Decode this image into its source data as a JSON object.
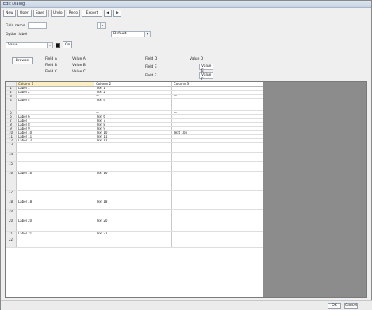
{
  "window": {
    "title": "Edit Dialog"
  },
  "toolbar": {
    "buttons": [
      {
        "name": "new-button",
        "label": "New"
      },
      {
        "name": "open-button",
        "label": "Open"
      },
      {
        "name": "save-button",
        "label": "Save"
      },
      {
        "name": "undo-button",
        "label": "Undo"
      },
      {
        "name": "redo-button",
        "label": "Redo"
      },
      {
        "name": "export-button",
        "label": "Export"
      },
      {
        "name": "prev-button",
        "label": "◀"
      },
      {
        "name": "next-button",
        "label": "▶"
      }
    ]
  },
  "settings": {
    "row1_label": "Field name",
    "row1_value": "",
    "row2_label": "Option label",
    "row2_value": "Default",
    "row3_value": "Value",
    "row3_check": "On",
    "ref_button": "Browse",
    "cols": [
      [
        "Field A",
        "Value A"
      ],
      [
        "Field B",
        "Value B"
      ],
      [
        "Field C",
        "Value C"
      ],
      [
        "Field D",
        "Value D"
      ],
      [
        "Field E",
        "Value E"
      ],
      [
        "Field F",
        "Value F"
      ]
    ]
  },
  "grid": {
    "headers": [
      "",
      "Column 1",
      "Column 2",
      "Column 3"
    ],
    "rows": [
      {
        "n": "1",
        "a": "Label 1",
        "b": "Text 1",
        "c": "",
        "h": 5
      },
      {
        "n": "2",
        "a": "Label 2",
        "b": "Text 2",
        "c": "",
        "h": 5
      },
      {
        "n": "3",
        "a": "",
        "b": "—",
        "c": "—",
        "h": 5
      },
      {
        "n": "4",
        "a": "Label 4",
        "b": "Text 4",
        "c": "",
        "h": 16
      },
      {
        "n": "5",
        "a": "",
        "b": "—",
        "c": "—",
        "h": 5
      },
      {
        "n": "6",
        "a": "Label 6",
        "b": "Text 6",
        "c": "",
        "h": 5
      },
      {
        "n": "7",
        "a": "Label 7",
        "b": "Text 7",
        "c": "",
        "h": 5
      },
      {
        "n": "8",
        "a": "Label 8",
        "b": "Text 8",
        "c": "",
        "h": 5
      },
      {
        "n": "9",
        "a": "Label 9",
        "b": "Text 9",
        "c": "",
        "h": 5
      },
      {
        "n": "10",
        "a": "Label 10",
        "b": "Text 10",
        "c": "Text 10b",
        "h": 5
      },
      {
        "n": "11",
        "a": "Label 11",
        "b": "Text 11",
        "c": "",
        "h": 5
      },
      {
        "n": "12",
        "a": "Label 12",
        "b": "Text 12",
        "c": "",
        "h": 5
      },
      {
        "n": "13",
        "a": "",
        "b": "",
        "c": "",
        "h": 12
      },
      {
        "n": "14",
        "a": "",
        "b": "",
        "c": "",
        "h": 12
      },
      {
        "n": "15",
        "a": "",
        "b": "",
        "c": "",
        "h": 12
      },
      {
        "n": "16",
        "a": "Label 16",
        "b": "Text 16",
        "c": "",
        "h": 24
      },
      {
        "n": "17",
        "a": "",
        "b": "",
        "c": "",
        "h": 12
      },
      {
        "n": "18",
        "a": "Label 18",
        "b": "Text 18",
        "c": "",
        "h": 12
      },
      {
        "n": "19",
        "a": "",
        "b": "",
        "c": "",
        "h": 12
      },
      {
        "n": "20",
        "a": "Label 20",
        "b": "Text 20",
        "c": "",
        "h": 16
      },
      {
        "n": "21",
        "a": "Label 21",
        "b": "Text 21",
        "c": "",
        "h": 8
      },
      {
        "n": "22",
        "a": "",
        "b": "",
        "c": "",
        "h": 12
      }
    ]
  },
  "status": {
    "ok_label": "OK",
    "cancel_label": "Cancel"
  }
}
